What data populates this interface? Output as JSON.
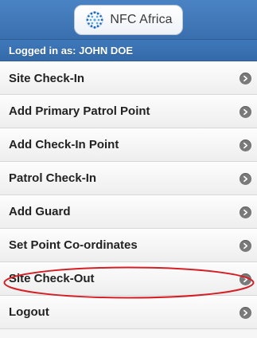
{
  "header": {
    "logo_text": "NFC Africa",
    "logo_icon": "nfc-globe-icon"
  },
  "status": {
    "text": "Logged in as: JOHN DOE"
  },
  "menu": {
    "items": [
      {
        "label": "Site Check-In",
        "icon": "chevron-right-icon"
      },
      {
        "label": "Add Primary Patrol Point",
        "icon": "chevron-right-icon"
      },
      {
        "label": "Add Check-In Point",
        "icon": "chevron-right-icon"
      },
      {
        "label": "Patrol Check-In",
        "icon": "chevron-right-icon"
      },
      {
        "label": "Add Guard",
        "icon": "chevron-right-icon"
      },
      {
        "label": "Set Point Co-ordinates",
        "icon": "chevron-right-icon"
      },
      {
        "label": "Site Check-Out",
        "icon": "chevron-right-icon"
      },
      {
        "label": "Logout",
        "icon": "chevron-right-icon"
      }
    ]
  },
  "colors": {
    "header_blue": "#3a6fae",
    "annotation_red": "#d51f26"
  }
}
